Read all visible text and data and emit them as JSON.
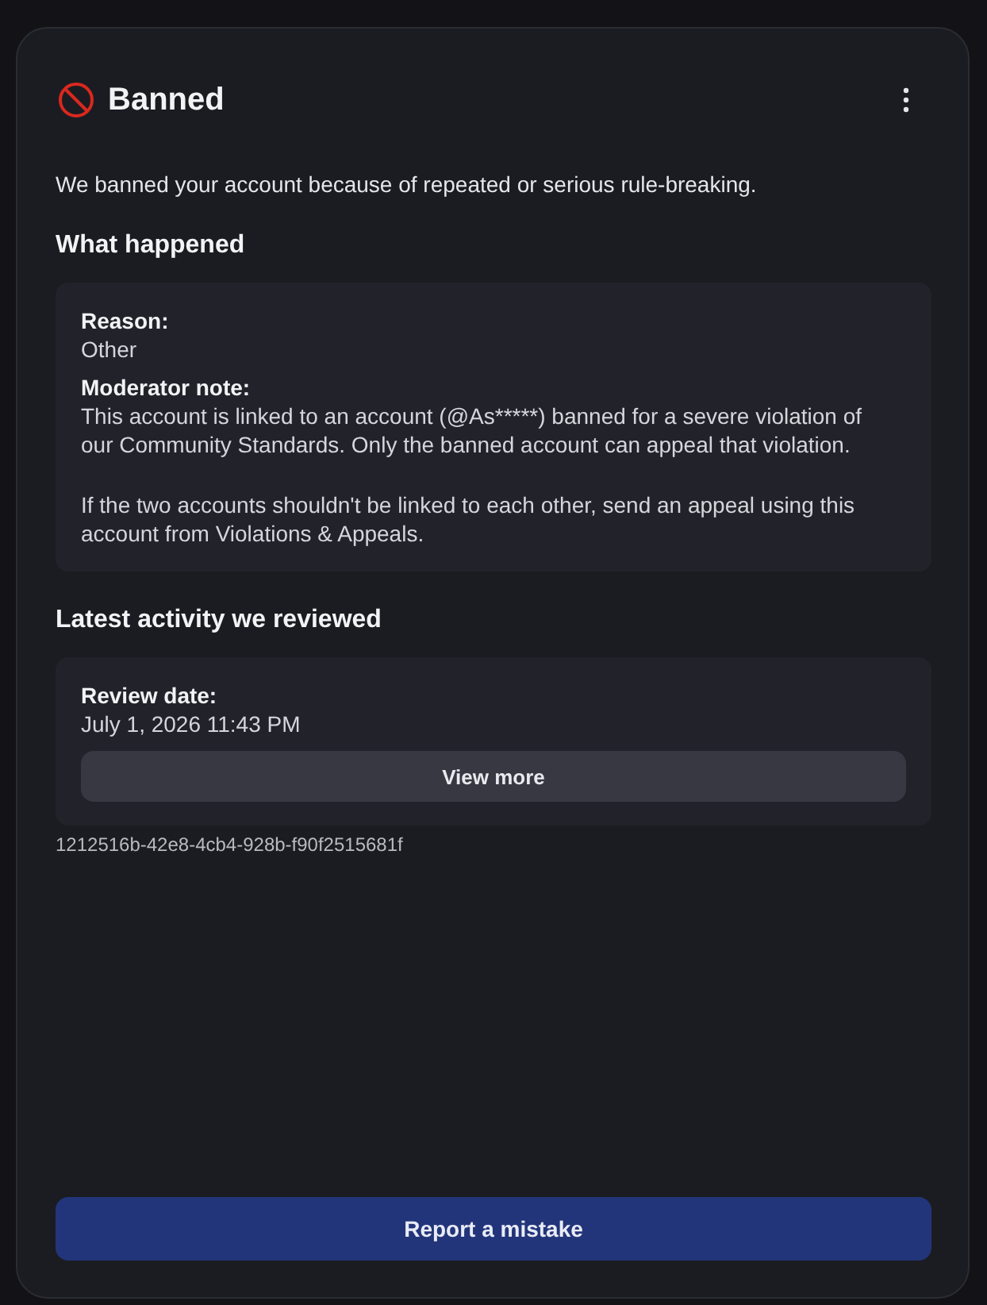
{
  "header": {
    "title": "Banned"
  },
  "intro": "We banned your account because of repeated or serious rule-breaking.",
  "sections": [
    {
      "heading": "What happened",
      "fields": [
        {
          "label": "Reason:",
          "paragraphs": [
            "Other"
          ]
        },
        {
          "label": "Moderator note:",
          "paragraphs": [
            "This account is linked to an account (@As*****) banned for a severe violation of our Community Standards. Only the banned account can appeal that violation.",
            "If the two accounts shouldn't be linked to each other, send an appeal using this account from Violations & Appeals."
          ]
        }
      ]
    },
    {
      "heading": "Latest activity we reviewed",
      "fields": [
        {
          "label": "Review date:",
          "paragraphs": [
            "July 1, 2026 11:43 PM"
          ]
        }
      ],
      "button": "View more"
    }
  ],
  "reference_id": "1212516b-42e8-4cb4-928b-f90f2515681f",
  "footer_button": "Report a mistake"
}
